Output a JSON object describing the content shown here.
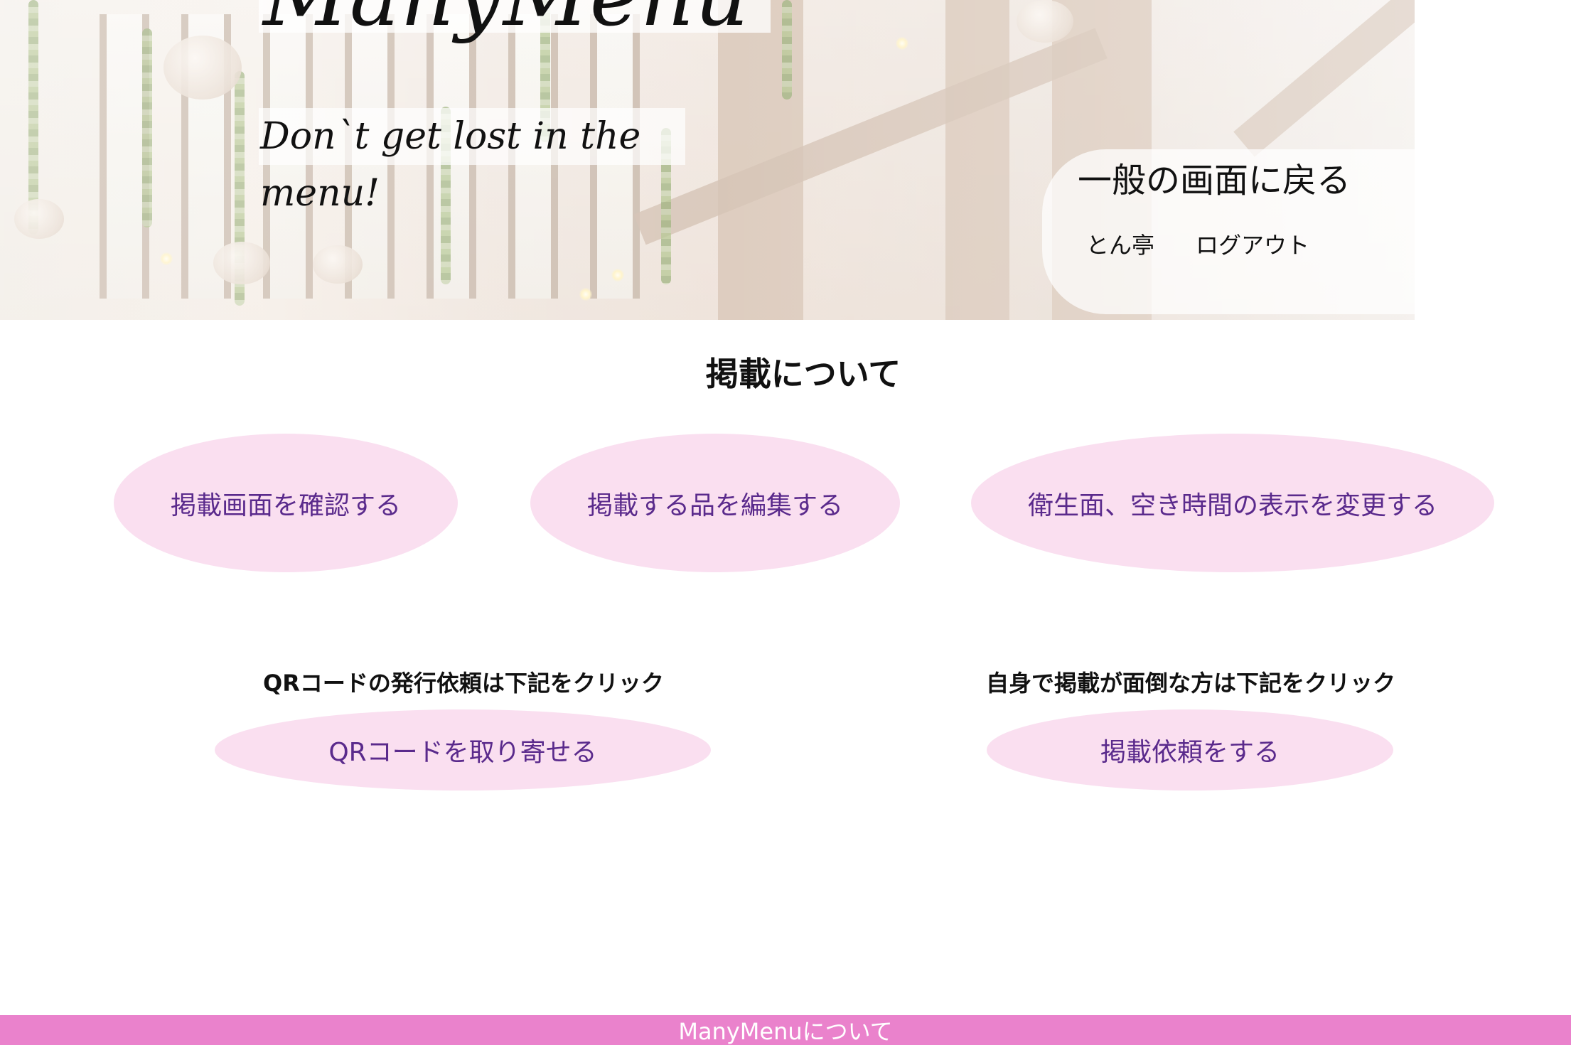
{
  "header": {
    "brand_title": "ManyMenu",
    "tagline": "Don`t get lost in the menu!"
  },
  "nav": {
    "back_to_general": "一般の画面に戻る",
    "shop_name": "とん亭",
    "logout": "ログアウト"
  },
  "main": {
    "section_title": "掲載について",
    "actions": {
      "view_listing": "掲載画面を確認する",
      "edit_items": "掲載する品を編集する",
      "hygiene_display": "衛生面、空き時間の表示を変更する"
    },
    "qr": {
      "hint": "QRコードの発行依頼は下記をクリック",
      "button": "QRコードを取り寄せる"
    },
    "request": {
      "hint": "自身で掲載が面倒な方は下記をクリック",
      "button": "掲載依頼をする"
    }
  },
  "footer": {
    "about_link": "ManyMenuについて"
  },
  "colors": {
    "pill_background": "#fadff0",
    "pill_text": "#5a2a8c",
    "footer_background": "#ea82cc",
    "footer_text": "#ffffff"
  }
}
